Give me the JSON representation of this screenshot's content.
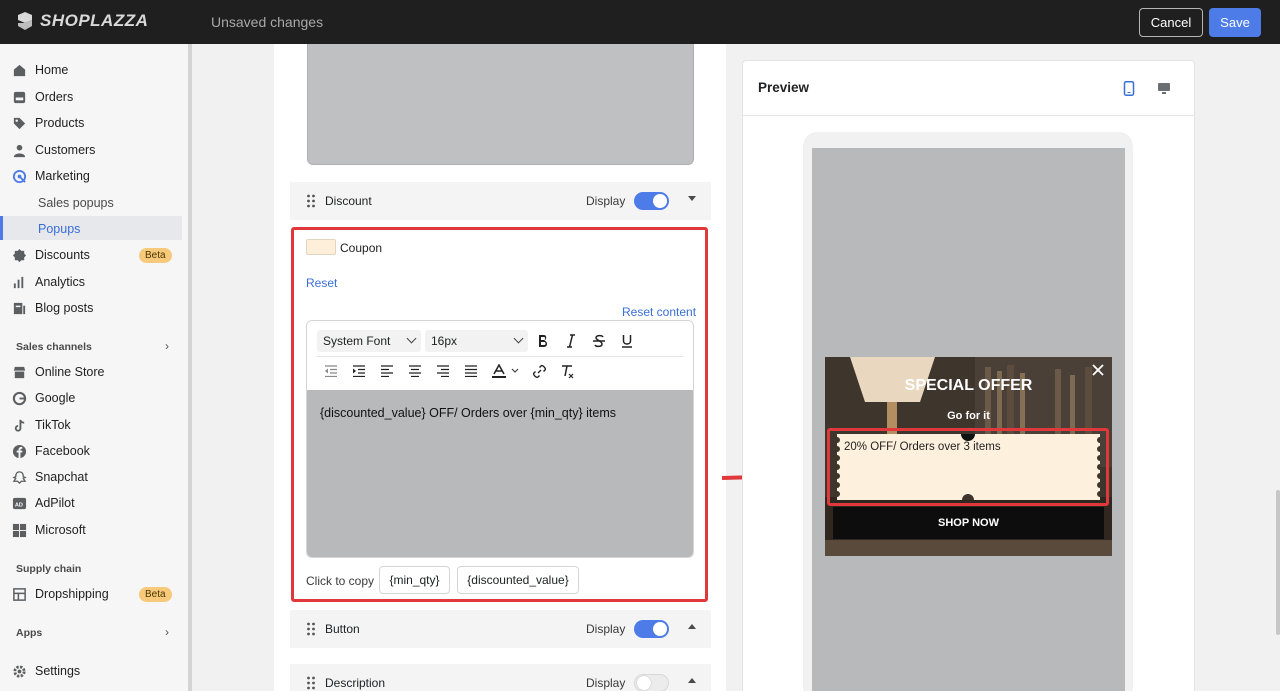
{
  "topbar": {
    "brand": "SHOPLAZZA",
    "status": "Unsaved changes",
    "cancel_label": "Cancel",
    "save_label": "Save"
  },
  "sidebar": {
    "items": [
      {
        "label": "Home",
        "icon": "home-icon"
      },
      {
        "label": "Orders",
        "icon": "orders-icon"
      },
      {
        "label": "Products",
        "icon": "tag-icon"
      },
      {
        "label": "Customers",
        "icon": "person-icon"
      },
      {
        "label": "Marketing",
        "icon": "marketing-icon"
      }
    ],
    "marketing_sub": [
      "Sales popups",
      "Popups"
    ],
    "items2": [
      {
        "label": "Discounts",
        "icon": "discount-icon",
        "badge": "Beta"
      },
      {
        "label": "Analytics",
        "icon": "analytics-icon"
      },
      {
        "label": "Blog posts",
        "icon": "blog-icon"
      }
    ],
    "sales_channels_title": "Sales channels",
    "channels": [
      "Online Store",
      "Google",
      "TikTok",
      "Facebook",
      "Snapchat",
      "AdPilot",
      "Microsoft"
    ],
    "supply_chain_title": "Supply chain",
    "dropshipping": {
      "label": "Dropshipping",
      "badge": "Beta"
    },
    "apps_title": "Apps",
    "settings_label": "Settings"
  },
  "editor": {
    "discount_row": {
      "title": "Discount",
      "display_label": "Display",
      "enabled": true
    },
    "coupon_label": "Coupon",
    "coupon_color": "#fdefd9",
    "reset_label": "Reset",
    "reset_content_label": "Reset content",
    "font_select": "System Font",
    "size_select": "16px",
    "content_text": "{discounted_value} OFF/ Orders over {min_qty} items",
    "click_to_copy": "Click to copy",
    "chips": [
      "{min_qty}",
      "{discounted_value}"
    ],
    "button_row": {
      "title": "Button",
      "display_label": "Display",
      "enabled": true
    },
    "description_row": {
      "title": "Description",
      "display_label": "Display",
      "enabled": false
    }
  },
  "preview": {
    "title": "Preview",
    "popup": {
      "title": "SPECIAL OFFER",
      "subtitle": "Go for it",
      "coupon_text": "20% OFF/ Orders over 3 items",
      "button_label": "SHOP NOW"
    }
  },
  "colors": {
    "accent": "#4d7ce8",
    "highlight": "#e0383b"
  }
}
